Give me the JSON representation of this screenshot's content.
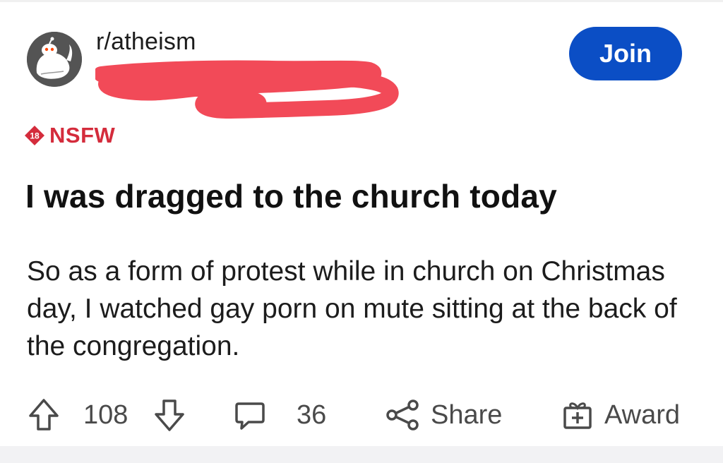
{
  "post": {
    "subreddit": "r/atheism",
    "join_label": "Join",
    "nsfw_badge_number": "18",
    "nsfw_label": "NSFW",
    "title": "I was dragged to the church today",
    "body": "So as a form of protest while in church on Christmas day, I watched gay porn on mute sitting at the back of the congregation."
  },
  "actions": {
    "upvote_count": "108",
    "comment_count": "36",
    "share_label": "Share",
    "award_label": "Award"
  },
  "icons": {
    "avatar": "reddit-alien-avatar-icon",
    "nsfw": "nsfw-badge-icon",
    "upvote": "arrow-up-icon",
    "downvote": "arrow-down-icon",
    "comment": "comment-bubble-icon",
    "share": "share-icon",
    "award": "gift-icon"
  },
  "colors": {
    "join_button": "#0b4ec5",
    "nsfw": "#d42c3c",
    "redaction": "#f24a58",
    "avatar_bg": "#545454",
    "action_text": "#4a4a4a"
  }
}
